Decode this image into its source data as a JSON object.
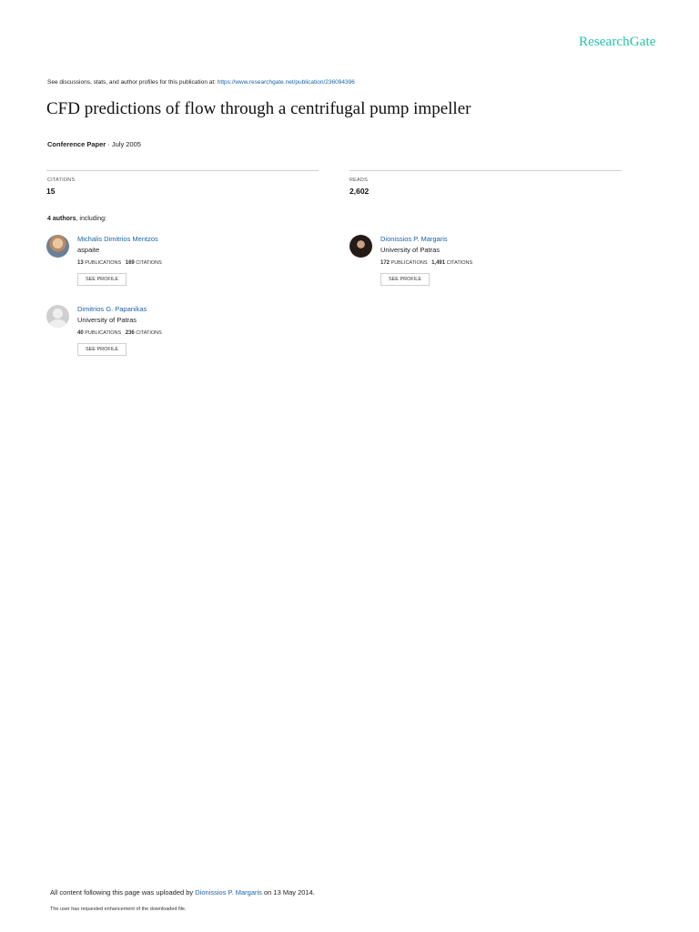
{
  "brand": "ResearchGate",
  "header": {
    "discuss_text": "See discussions, stats, and author profiles for this publication at: ",
    "discuss_link": "https://www.researchgate.net/publication/236094396"
  },
  "paper": {
    "title": "CFD predictions of flow through a centrifugal pump impeller",
    "type": "Conference Paper",
    "date_sep": " · ",
    "date": "July 2005"
  },
  "stats": {
    "citations_label": "CITATIONS",
    "citations_value": "15",
    "reads_label": "READS",
    "reads_value": "2,602"
  },
  "authors_header": {
    "count": "4 authors",
    "suffix": ", including:"
  },
  "authors": [
    {
      "name": "Michalis Dimitrios Mentzos",
      "institution": "aspaite",
      "publications": "13",
      "publications_label": "PUBLICATIONS",
      "citations": "169",
      "citations_label": "CITATIONS",
      "button": "SEE PROFILE"
    },
    {
      "name": "Dionissios P. Margaris",
      "institution": "University of Patras",
      "publications": "172",
      "publications_label": "PUBLICATIONS",
      "citations": "1,491",
      "citations_label": "CITATIONS",
      "button": "SEE PROFILE"
    },
    {
      "name": "Dimitrios G. Papanikas",
      "institution": "University of Patras",
      "publications": "40",
      "publications_label": "PUBLICATIONS",
      "citations": "236",
      "citations_label": "CITATIONS",
      "button": "SEE PROFILE"
    }
  ],
  "footer": {
    "upload_prefix": "All content following this page was uploaded by ",
    "uploader": "Dionissios P. Margaris",
    "upload_suffix": " on 13 May 2014.",
    "note": "The user has requested enhancement of the downloaded file."
  },
  "colors": {
    "brand": "#1fc4a8",
    "link": "#1a63a8"
  }
}
